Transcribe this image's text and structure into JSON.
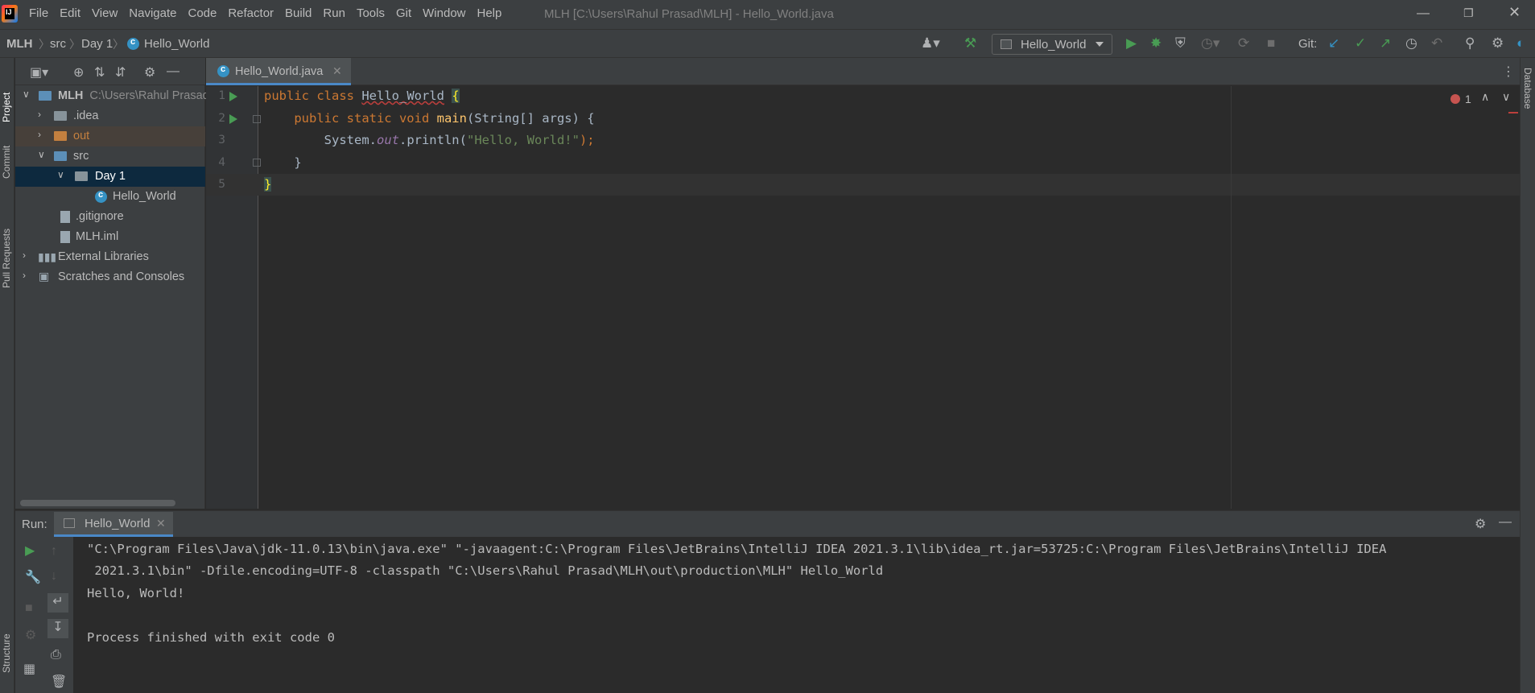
{
  "menubar": {
    "items": [
      "File",
      "Edit",
      "View",
      "Navigate",
      "Code",
      "Refactor",
      "Build",
      "Run",
      "Tools",
      "Git",
      "Window",
      "Help"
    ],
    "window_title": "MLH [C:\\Users\\Rahul Prasad\\MLH] - Hello_World.java"
  },
  "navbar": {
    "crumbs": [
      "MLH",
      "src",
      "Day 1",
      "Hello_World"
    ],
    "run_config": "Hello_World",
    "git_label": "Git:"
  },
  "left_stripe": {
    "project": "Project",
    "commit": "Commit",
    "pull_requests": "Pull Requests",
    "structure": "Structure"
  },
  "right_stripe": {
    "database": "Database"
  },
  "project_tree": [
    {
      "label": "MLH",
      "sub": "C:\\Users\\Rahul Prasad"
    },
    {
      "label": ".idea"
    },
    {
      "label": "out"
    },
    {
      "label": "src"
    },
    {
      "label": "Day 1"
    },
    {
      "label": "Hello_World"
    },
    {
      "label": ".gitignore"
    },
    {
      "label": "MLH.iml"
    },
    {
      "label": "External Libraries"
    },
    {
      "label": "Scratches and Consoles"
    }
  ],
  "editor": {
    "tab_label": "Hello_World.java",
    "line_numbers": [
      "1",
      "2",
      "3",
      "4",
      "5"
    ],
    "error_count": "1",
    "code": {
      "l1_kw": "public class ",
      "l1_name": "Hello_World",
      "l1_brace": "{",
      "l2_indent": "    ",
      "l2_kw": "public static void ",
      "l2_fn": "main",
      "l2_rest": "(String[] args) {",
      "l3_a": "        System.",
      "l3_out": "out",
      "l3_b": ".println(",
      "l3_str": "\"Hello, World!\"",
      "l3_c": ");",
      "l4": "    }",
      "l5": "}"
    }
  },
  "run_panel": {
    "label": "Run:",
    "tab_label": "Hello_World",
    "console_lines": [
      "\"C:\\Program Files\\Java\\jdk-11.0.13\\bin\\java.exe\" \"-javaagent:C:\\Program Files\\JetBrains\\IntelliJ IDEA 2021.3.1\\lib\\idea_rt.jar=53725:C:\\Program Files\\JetBrains\\IntelliJ IDEA",
      " 2021.3.1\\bin\" -Dfile.encoding=UTF-8 -classpath \"C:\\Users\\Rahul Prasad\\MLH\\out\\production\\MLH\" Hello_World",
      "Hello, World!",
      "",
      "Process finished with exit code 0"
    ]
  },
  "colors": {
    "accent": "#4a88c7",
    "keyword": "#cc7832",
    "string": "#6a8759",
    "function": "#ffc66d",
    "run_green": "#499c54"
  }
}
